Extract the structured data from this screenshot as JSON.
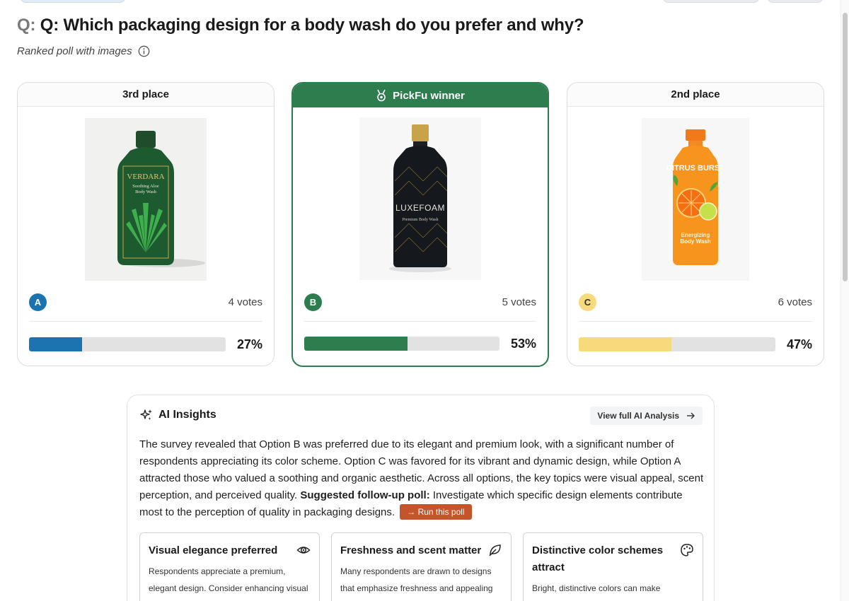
{
  "question": {
    "prefix": "Q:",
    "text": "Q: Which packaging design for a body wash do you prefer and why?",
    "subtitle": "Ranked poll with images"
  },
  "options": [
    {
      "header": "3rd place",
      "letter": "A",
      "letter_color": "#1b73b0",
      "votes": "4 votes",
      "percent": "27%",
      "percent_value": 27,
      "bar_color": "#1b73b0",
      "image_desc": "green-aloe-bottle",
      "bottle_brand": "VERDARA",
      "bottle_line1": "Soothing Aloe",
      "bottle_line2": "Body Wash"
    },
    {
      "header": "PickFu winner",
      "letter": "B",
      "letter_color": "#2e7d4f",
      "votes": "5 votes",
      "percent": "53%",
      "percent_value": 53,
      "bar_color": "#2e7d4f",
      "image_desc": "black-gold-bottle",
      "bottle_brand": "LUXEFOAM",
      "bottle_line1": "Premium Body Wash"
    },
    {
      "header": "2nd place",
      "letter": "C",
      "letter_color": "#f6da7c",
      "votes": "6 votes",
      "percent": "47%",
      "percent_value": 47,
      "bar_color": "#f6da7c",
      "image_desc": "orange-citrus-bottle",
      "bottle_brand": "CITRUS BURST",
      "bottle_line1": "Energizing",
      "bottle_line2": "Body Wash"
    }
  ],
  "insights": {
    "title": "AI Insights",
    "view_full": "View full AI Analysis",
    "body": "The survey revealed that Option B was preferred due to its elegant and premium look, with a significant number of respondents appreciating its color scheme. Option C was favored for its vibrant and dynamic design, while Option A attracted those who valued a soothing and organic aesthetic. Across all options, the key topics were visual appeal, scent perception, and perceived quality.",
    "followup_label": "Suggested follow-up poll:",
    "followup_text": "Investigate which specific design elements contribute most to the perception of quality in packaging designs.",
    "run_button": "→ Run this poll",
    "cards": [
      {
        "title": "Visual elegance preferred",
        "text": "Respondents appreciate a premium, elegant design. Consider enhancing visual",
        "icon": "eye-icon"
      },
      {
        "title": "Freshness and scent matter",
        "text": "Many respondents are drawn to designs that emphasize freshness and appealing",
        "icon": "leaf-icon"
      },
      {
        "title": "Distinctive color schemes attract",
        "text": "Bright, distinctive colors can make",
        "icon": "palette-icon"
      }
    ]
  }
}
